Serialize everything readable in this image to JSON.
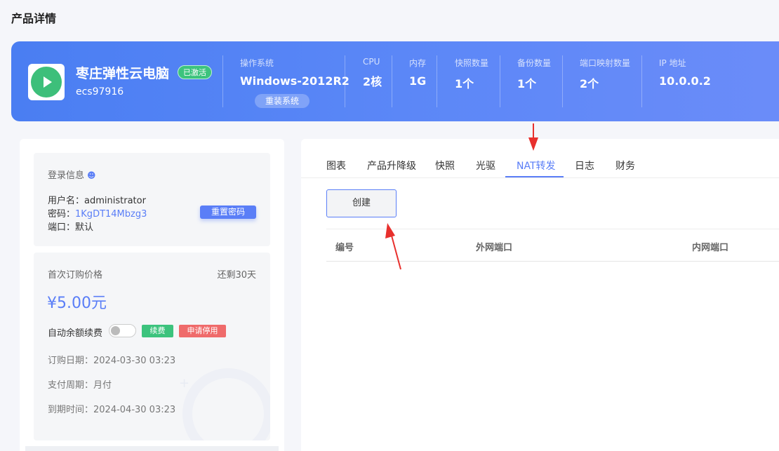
{
  "page_title": "产品详情",
  "product": {
    "name": "枣庄弹性云电脑",
    "status_badge": "已激活",
    "id": "ecs97916",
    "os_label": "操作系统",
    "os_value": "Windows-2012R2",
    "reinstall_label": "重装系统",
    "stats": [
      {
        "label": "CPU",
        "value": "2核"
      },
      {
        "label": "内存",
        "value": "1G"
      },
      {
        "label": "快照数量",
        "value": "1个"
      },
      {
        "label": "备份数量",
        "value": "1个"
      },
      {
        "label": "端口映射数量",
        "value": "2个"
      },
      {
        "label": "IP 地址",
        "value": "10.0.0.2"
      }
    ]
  },
  "login": {
    "title": "登录信息",
    "username_label": "用户名：",
    "username": "administrator",
    "password_label": "密码：",
    "password": "1KgDT14Mbzg3",
    "port_label": "端口：",
    "port": "默认",
    "reset_label": "重置密码"
  },
  "billing": {
    "first_price_label": "首次订购价格",
    "remaining": "还剩30天",
    "price": "¥5.00元",
    "auto_renew_label": "自动余额续费",
    "renew_label": "续费",
    "stop_label": "申请停用",
    "order_date": "订购日期：2024-03-30 03:23",
    "cycle": "支付周期：月付",
    "expire": "到期时间：2024-04-30 03:23"
  },
  "tabs": [
    "图表",
    "产品升降级",
    "快照",
    "光驱",
    "NAT转发",
    "日志",
    "财务"
  ],
  "active_tab": "NAT转发",
  "nat": {
    "create_label": "创建",
    "columns": [
      "编号",
      "外网端口",
      "内网端口"
    ]
  },
  "colors": {
    "accent": "#5a7ef7",
    "green": "#3cc37d",
    "red": "#ef6b6b",
    "annotation": "#e8302d"
  }
}
